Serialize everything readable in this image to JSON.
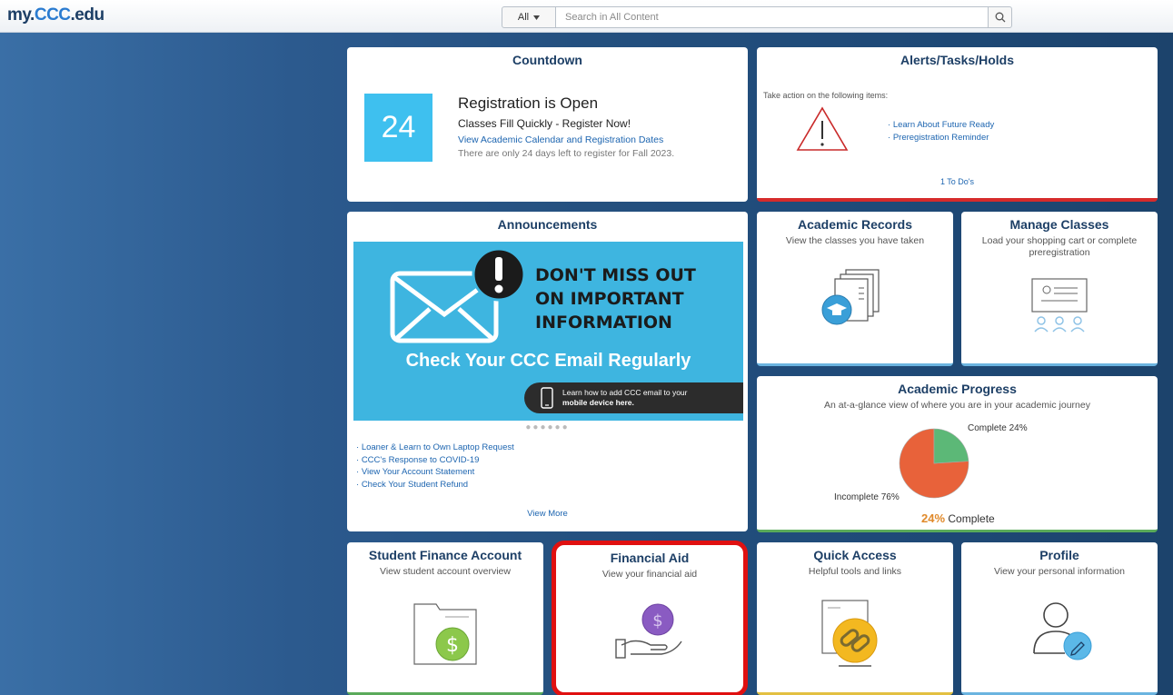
{
  "header": {
    "logo_prefix": "my.",
    "logo_accent": "CCC",
    "logo_suffix": ".edu",
    "search_scope": "All",
    "search_placeholder": "Search in All Content"
  },
  "countdown": {
    "title": "Countdown",
    "days": "24",
    "heading": "Registration is Open",
    "subheading": "Classes Fill Quickly - Register Now!",
    "link": "View Academic Calendar and Registration Dates",
    "note": "There are only 24 days left to register for Fall 2023."
  },
  "alerts": {
    "title": "Alerts/Tasks/Holds",
    "intro": "Take action on the following items:",
    "items": [
      "Learn About Future Ready",
      "Preregistration Reminder"
    ],
    "footer": "1 To Do's"
  },
  "announcements": {
    "title": "Announcements",
    "banner_line1": "DON'T MISS OUT",
    "banner_line2": "ON IMPORTANT",
    "banner_line3": "INFORMATION",
    "banner_check": "Check Your CCC Email Regularly",
    "banner_mobile_1": "Learn how to add CCC email to your",
    "banner_mobile_2": "mobile device here.",
    "dots": "●●●●●●",
    "links": [
      "Loaner & Learn to Own Laptop Request",
      "CCC's Response to COVID-19",
      "View Your Account Statement",
      "Check Your Student Refund"
    ],
    "view_more": "View More"
  },
  "academic_records": {
    "title": "Academic Records",
    "subtitle": "View the classes you have taken"
  },
  "manage_classes": {
    "title": "Manage Classes",
    "subtitle": "Load your shopping cart or complete preregistration"
  },
  "academic_progress": {
    "title": "Academic Progress",
    "subtitle": "An at-a-glance view of where you are in your academic journey",
    "complete_label": "Complete 24%",
    "incomplete_label": "Incomplete 76%",
    "summary_pct": "24%",
    "summary_label": "Complete",
    "complete_pct": 24,
    "colors": {
      "complete": "#5cb877",
      "incomplete": "#e8623a"
    }
  },
  "student_finance": {
    "title": "Student Finance Account",
    "subtitle": "View student account overview"
  },
  "financial_aid": {
    "title": "Financial Aid",
    "subtitle": "View your financial aid"
  },
  "quick_access": {
    "title": "Quick Access",
    "subtitle": "Helpful tools and links"
  },
  "profile": {
    "title": "Profile",
    "subtitle": "View your personal information"
  },
  "colors": {
    "brand_dark": "#1d3f66",
    "link": "#1d65b0",
    "countdown_bg": "#3ec0ef",
    "highlight": "#e01010"
  }
}
